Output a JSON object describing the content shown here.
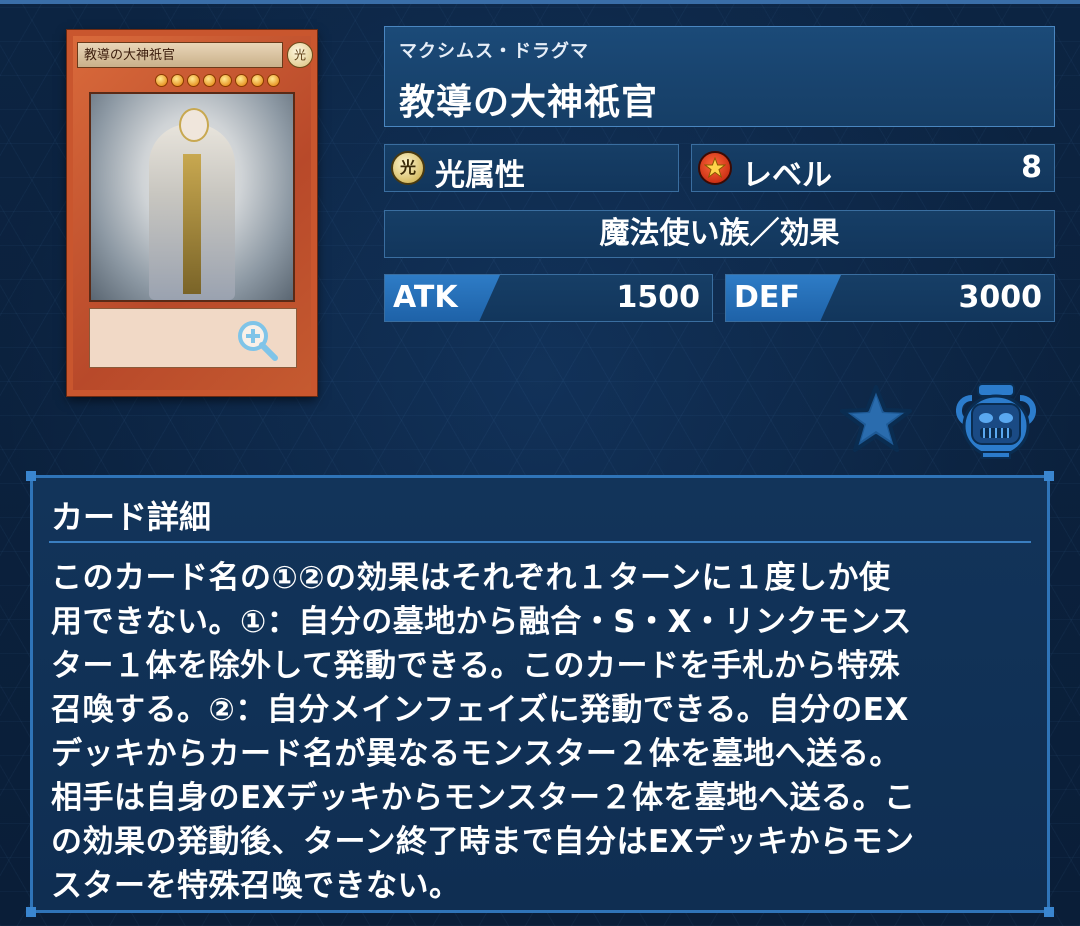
{
  "card": {
    "name": "教導の大神祇官",
    "reading": "マクシムス・ドラグマ",
    "attribute": "光属性",
    "attribute_glyph": "光",
    "level_label": "レベル",
    "level": "8",
    "type": "魔法使い族／効果",
    "atk_label": "ATK",
    "atk": "1500",
    "def_label": "DEF",
    "def": "3000",
    "card_attr_glyph": "光"
  },
  "detail": {
    "title": "カード詳細",
    "text": "このカード名の①②の効果はそれぞれ１ターンに１度しか使\n用できない。①：自分の墓地から融合・S・X・リンクモンス\nター１体を除外して発動できる。このカードを手札から特殊\n召喚する。②：自分メインフェイズに発動できる。自分のEX\nデッキからカード名が異なるモンスター２体を墓地へ送る。\n相手は自身のEXデッキからモンスター２体を墓地へ送る。こ\nの効果の発動後、ターン終了時まで自分はEXデッキからモン\nスターを特殊召喚できない。"
  },
  "icons": {
    "zoom": "zoom-in-icon",
    "favorite": "star-icon",
    "pot": "pot-of-greed-icon"
  },
  "colors": {
    "background": "#0a1f3a",
    "panel": "#163e66",
    "panel_border": "#3a6ea0",
    "accent_tag": "#2e7cc6",
    "card_frame": "#c9562e"
  }
}
